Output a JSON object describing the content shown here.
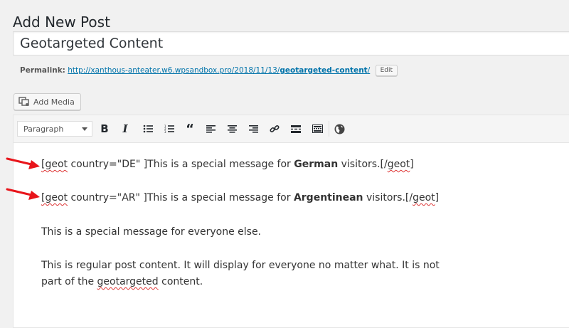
{
  "page": {
    "title": "Add New Post"
  },
  "post": {
    "title": "Geotargeted Content"
  },
  "permalink": {
    "label": "Permalink:",
    "url_base": "http://xanthous-anteater.w6.wpsandbox.pro/2018/11/13/",
    "slug": "geotargeted-content",
    "url_end": "/",
    "edit_label": "Edit"
  },
  "media": {
    "add_label": "Add Media",
    "icon": "media-icon"
  },
  "toolbar": {
    "format_value": "Paragraph",
    "buttons": [
      "bold",
      "italic",
      "bulleted-list",
      "numbered-list",
      "blockquote",
      "align-left",
      "align-center",
      "align-right",
      "link",
      "read-more",
      "toolbar-toggle",
      "geot"
    ]
  },
  "content": {
    "line1": {
      "open": "[geot",
      "attr": " country=\"DE\" ]This is a special message for ",
      "bold": "German",
      "after": " visitors.[/",
      "close": "geot",
      "end": "]"
    },
    "line2": {
      "open": "[geot",
      "attr": " country=\"AR\" ]This is a special message for ",
      "bold": "Argentinean",
      "after": " visitors.[/",
      "close": "geot",
      "end": "]"
    },
    "line3": "This is a special message for everyone else.",
    "line4a": "This is regular post content. It will display for everyone no matter what. It is not",
    "line4b_pre": "part of the ",
    "line4b_sq": "geotargeted",
    "line4b_post": " content."
  },
  "colors": {
    "accent": "#0073aa",
    "arrow": "#e8151b",
    "spell": "#dd3333"
  }
}
